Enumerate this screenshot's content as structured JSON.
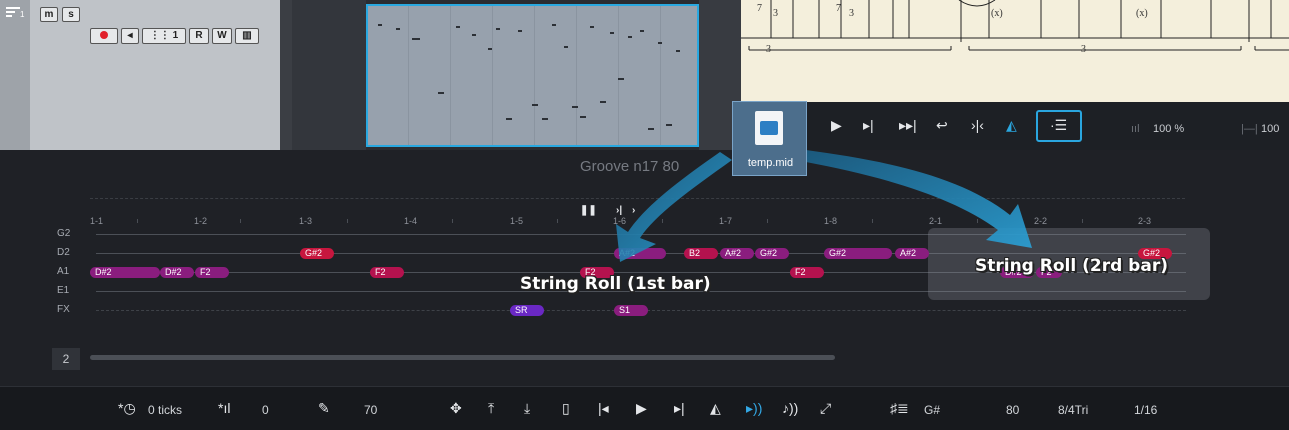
{
  "track_header": {
    "track_number": "1",
    "mute_label": "m",
    "solo_label": "s",
    "channel_label": "1",
    "read_label": "R",
    "write_label": "W"
  },
  "transport": {
    "zoom1": "100 %",
    "zoom2": "100"
  },
  "drag_file": {
    "filename": "temp.mid"
  },
  "editor": {
    "title": "Groove n17 80",
    "page_number": "2",
    "ruler": [
      "1-1",
      "1-2",
      "1-3",
      "1-4",
      "1-5",
      "1-6",
      "1-7",
      "1-8",
      "2-1",
      "2-2",
      "2-3"
    ],
    "strings": [
      "G2",
      "D2",
      "A1",
      "E1",
      "FX"
    ],
    "notes_d2": [
      "G#2",
      "A#2",
      "B2",
      "A#2",
      "G#2",
      "G#2",
      "A#2",
      "G#2"
    ],
    "notes_a1": [
      "D#2",
      "D#2",
      "F2",
      "F2",
      "F2",
      "F2",
      "D#2",
      "F2"
    ],
    "notes_fx": [
      "SR",
      "S1"
    ],
    "caption1": "String Roll (1st bar)",
    "caption2": "String Roll (2rd bar)"
  },
  "statusbar": {
    "ticks": "0 ticks",
    "velocity": "0",
    "pencil_value": "70",
    "key": "G#",
    "tempo": "80",
    "time_signature": "8/4Tri",
    "quantize": "1/16"
  },
  "colors": {
    "accent": "#2aa6df",
    "note_pink": "#b4124e",
    "note_purple": "#8a1d7e",
    "note_violet": "#6a28c4"
  }
}
